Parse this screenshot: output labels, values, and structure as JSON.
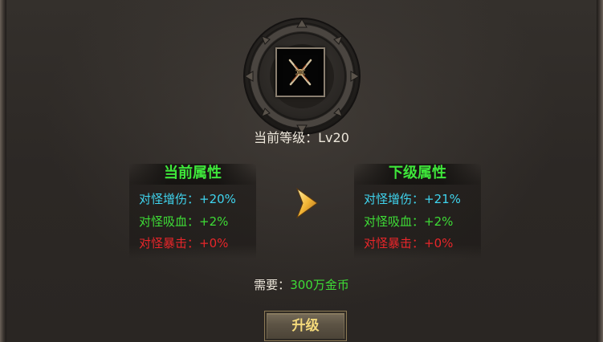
{
  "item": {
    "icon": "crossed-swords-icon"
  },
  "level": {
    "label": "当前等级：",
    "value": "Lv20"
  },
  "current": {
    "title": "当前属性",
    "rows": [
      {
        "label": "对怪增伤：",
        "value": "+20%",
        "color": "#3fd4ee"
      },
      {
        "label": "对怪吸血：",
        "value": "+2%",
        "color": "#3edc36"
      },
      {
        "label": "对怪暴击：",
        "value": "+0%",
        "color": "#e8262a"
      }
    ]
  },
  "next": {
    "title": "下级属性",
    "rows": [
      {
        "label": "对怪增伤：",
        "value": "+21%",
        "color": "#3fd4ee"
      },
      {
        "label": "对怪吸血：",
        "value": "+2%",
        "color": "#3edc36"
      },
      {
        "label": "对怪暴击：",
        "value": "+0%",
        "color": "#e8262a"
      }
    ]
  },
  "arrow_icon": "chevron-right-icon",
  "requirement": {
    "label": "需要：",
    "cost": "300万金币"
  },
  "upgrade_button": {
    "label": "升级"
  },
  "colors": {
    "title_green": "#3ee63a",
    "button_text": "#f3d97a",
    "arrow_gold": "#f2b535"
  }
}
